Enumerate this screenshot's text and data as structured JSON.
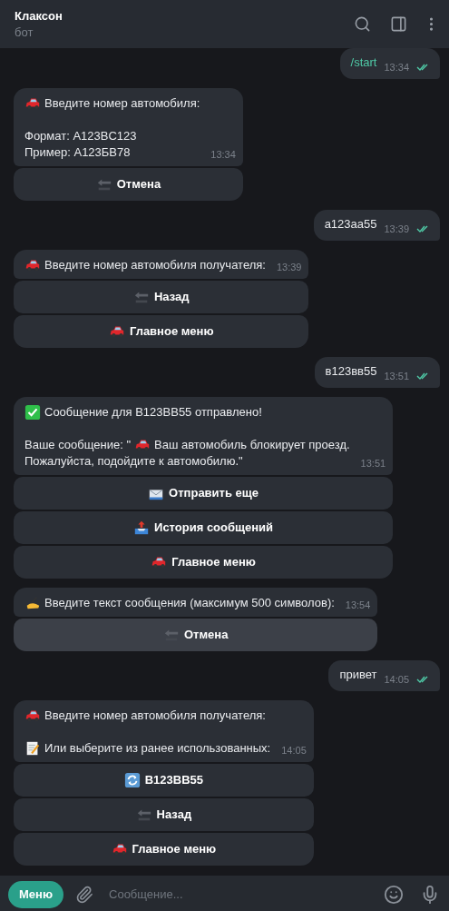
{
  "header": {
    "title": "Клаксон",
    "subtitle": "бот"
  },
  "messages": [
    {
      "kind": "outgoing",
      "command": true,
      "text": "/start",
      "time": "13:34",
      "read": true
    },
    {
      "kind": "incoming",
      "paragraphs": [
        {
          "lines": [
            [
              {
                "kind": "car"
              },
              {
                "kind": "text",
                "text": "Введите номер автомобиля:"
              }
            ]
          ]
        },
        {
          "lines": [
            [
              {
                "kind": "text",
                "text": "Формат: A123BC123"
              }
            ],
            [
              {
                "kind": "text",
                "text": "Пример: A123БВ78"
              }
            ]
          ]
        }
      ],
      "time": "13:34",
      "buttons": [
        {
          "kind": "back",
          "label": "Отмена",
          "selected": false
        }
      ]
    },
    {
      "kind": "outgoing",
      "command": false,
      "text": "а123аа55",
      "time": "13:39",
      "read": true
    },
    {
      "kind": "incoming",
      "paragraphs": [
        {
          "lines": [
            [
              {
                "kind": "car"
              },
              {
                "kind": "text",
                "text": "Введите номер автомобиля получателя:"
              }
            ]
          ]
        }
      ],
      "time": "13:39",
      "buttons": [
        {
          "kind": "back",
          "label": "Назад",
          "selected": false
        },
        {
          "kind": "car",
          "label": "Главное меню",
          "selected": false
        }
      ]
    },
    {
      "kind": "outgoing",
      "command": false,
      "text": "в123вв55",
      "time": "13:51",
      "read": true
    },
    {
      "kind": "incoming",
      "paragraphs": [
        {
          "lines": [
            [
              {
                "kind": "check"
              },
              {
                "kind": "text",
                "text": "Сообщение для B123BB55 отправлено!"
              }
            ]
          ]
        },
        {
          "lines": [
            [
              {
                "kind": "text",
                "text": "Ваше сообщение: \""
              },
              {
                "kind": "car"
              },
              {
                "kind": "text",
                "text": "Ваш автомобиль блокирует проезд."
              }
            ],
            [
              {
                "kind": "text",
                "text": "Пожалуйста, подойдите к автомобилю.\""
              }
            ]
          ]
        }
      ],
      "time": "13:51",
      "buttons": [
        {
          "kind": "mail",
          "label": "Отправить еще",
          "selected": false
        },
        {
          "kind": "outbox",
          "label": "История сообщений",
          "selected": false
        },
        {
          "kind": "car",
          "label": "Главное меню",
          "selected": false
        }
      ]
    },
    {
      "kind": "incoming",
      "paragraphs": [
        {
          "lines": [
            [
              {
                "kind": "hand"
              },
              {
                "kind": "text",
                "text": "Введите текст сообщения (максимум 500 символов):"
              }
            ]
          ]
        }
      ],
      "time": "13:54",
      "buttons": [
        {
          "kind": "back",
          "label": "Отмена",
          "selected": true
        }
      ]
    },
    {
      "kind": "outgoing",
      "command": false,
      "text": "привет",
      "time": "14:05",
      "read": true
    },
    {
      "kind": "incoming",
      "paragraphs": [
        {
          "lines": [
            [
              {
                "kind": "car"
              },
              {
                "kind": "text",
                "text": "Введите номер автомобиля получателя:"
              }
            ]
          ]
        },
        {
          "lines": [
            [
              {
                "kind": "memo"
              },
              {
                "kind": "text",
                "text": "Или выберите из ранее использованных:"
              }
            ]
          ]
        }
      ],
      "time": "14:05",
      "buttons": [
        {
          "kind": "refresh",
          "label": "B123BB55",
          "selected": false
        },
        {
          "kind": "back",
          "label": "Назад",
          "selected": false
        },
        {
          "kind": "car",
          "label": "Главное меню",
          "selected": false
        }
      ]
    }
  ],
  "composer": {
    "menu_label": "Меню",
    "placeholder": "Сообщение..."
  }
}
